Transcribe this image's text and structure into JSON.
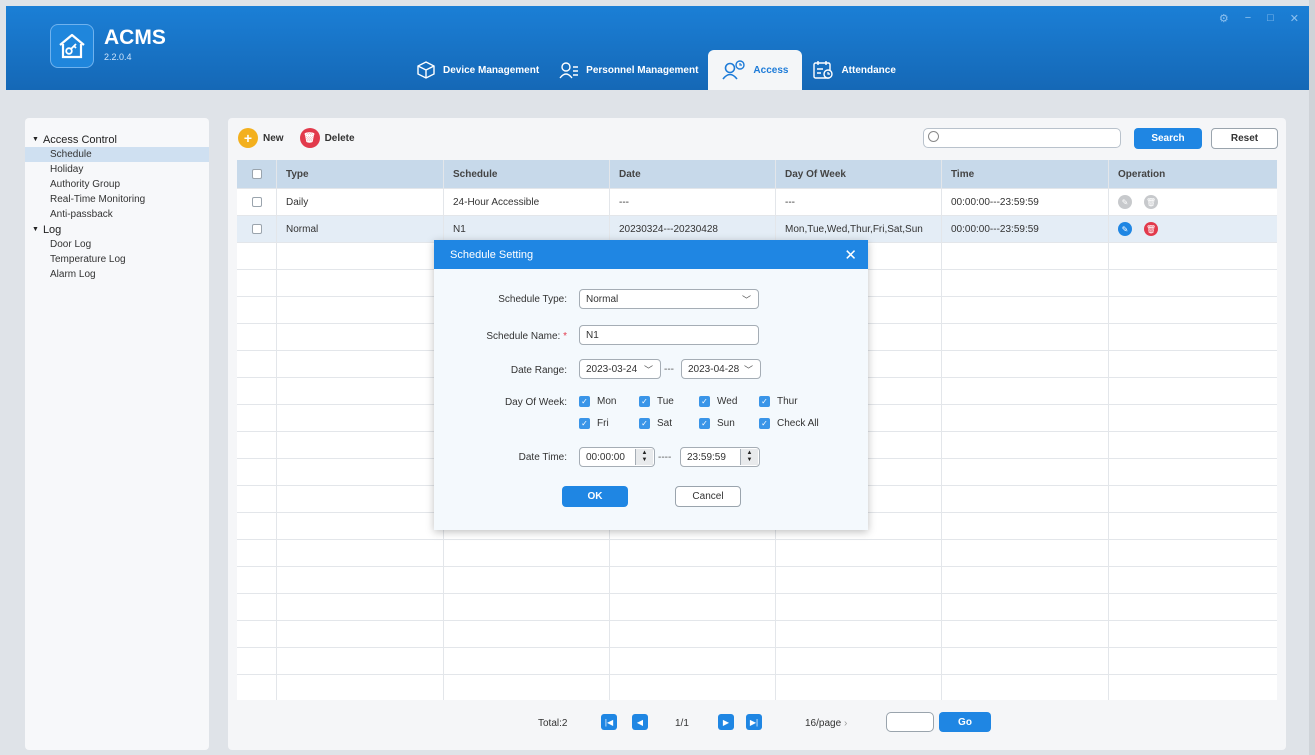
{
  "app": {
    "title": "ACMS",
    "version": "2.2.0.4"
  },
  "window_controls": [
    "⚙",
    "−",
    "□",
    "✕"
  ],
  "nav": [
    {
      "label": "Device Management",
      "icon": "device-icon"
    },
    {
      "label": "Personnel Management",
      "icon": "personnel-icon"
    },
    {
      "label": "Access",
      "icon": "access-icon",
      "active": true
    },
    {
      "label": "Attendance",
      "icon": "attendance-icon"
    }
  ],
  "sidebar": {
    "groups": [
      {
        "label": "Access Control",
        "items": [
          "Schedule",
          "Holiday",
          "Authority Group",
          "Real-Time Monitoring",
          "Anti-passback"
        ],
        "selected": "Schedule"
      },
      {
        "label": "Log",
        "items": [
          "Door Log",
          "Temperature Log",
          "Alarm Log"
        ]
      }
    ]
  },
  "toolbar": {
    "new_label": "New",
    "delete_label": "Delete",
    "search_label": "Search",
    "reset_label": "Reset",
    "search_value": ""
  },
  "table": {
    "columns": [
      "Type",
      "Schedule",
      "Date",
      "Day Of Week",
      "Time",
      "Operation"
    ],
    "rows": [
      {
        "type": "Daily",
        "schedule": "24-Hour Accessible",
        "date": "---",
        "day_of_week": "---",
        "time": "00:00:00---23:59:59"
      },
      {
        "type": "Normal",
        "schedule": "N1",
        "date": "20230324---20230428",
        "day_of_week": "Mon,Tue,Wed,Thur,Fri,Sat,Sun",
        "time": "00:00:00---23:59:59"
      }
    ]
  },
  "pager": {
    "total": "Total:2",
    "page": "1/1",
    "per_page": "16/page",
    "go_label": "Go"
  },
  "modal": {
    "title": "Schedule Setting",
    "schedule_type_label": "Schedule Type:",
    "schedule_type_value": "Normal",
    "schedule_name_label": "Schedule Name:",
    "schedule_name_value": "N1",
    "date_range_label": "Date Range:",
    "date_from": "2023-03-24",
    "date_to": "2023-04-28",
    "date_separator": "---",
    "day_of_week_label": "Day Of Week:",
    "days": [
      "Mon",
      "Tue",
      "Wed",
      "Thur",
      "Fri",
      "Sat",
      "Sun",
      "Check All"
    ],
    "date_time_label": "Date Time:",
    "time_from": "00:00:00",
    "time_to": "23:59:59",
    "time_separator": "----",
    "ok_label": "OK",
    "cancel_label": "Cancel"
  },
  "colors": {
    "primary": "#1f86e3",
    "danger": "#e23a4c",
    "new_button": "#f3b01e",
    "header": "#1b7fd6"
  }
}
